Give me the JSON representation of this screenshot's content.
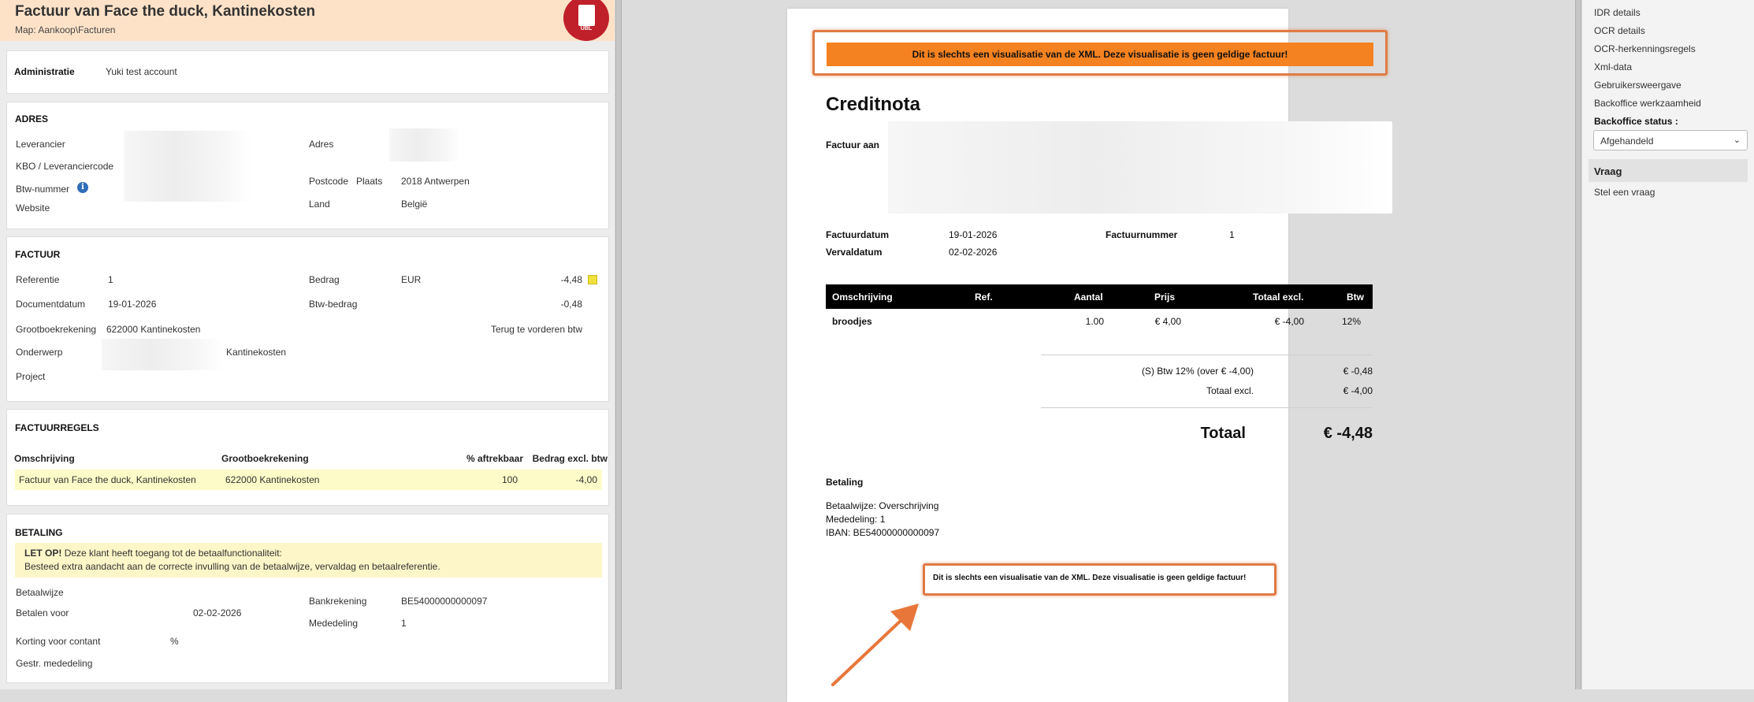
{
  "header": {
    "title": "Factuur van Face the duck, Kantinekosten",
    "folder": "Map: Aankoop\\Facturen",
    "ubl_label": "UBL"
  },
  "admin": {
    "label": "Administratie",
    "value": "Yuki test account"
  },
  "adres": {
    "title": "ADRES",
    "leverancier": "Leverancier",
    "kbo": "KBO / Leveranciercode",
    "btw": "Btw-nummer",
    "website": "Website",
    "adres": "Adres",
    "postcode": "Postcode",
    "plaats": "Plaats",
    "plaats_value": "2018 Antwerpen",
    "land": "Land",
    "land_value": "België"
  },
  "factuur": {
    "title": "FACTUUR",
    "referentie": "Referentie",
    "referentie_value": "1",
    "documentdatum": "Documentdatum",
    "documentdatum_value": "19-01-2026",
    "grootboek": "Grootboekrekening",
    "grootboek_value": "622000 Kantinekosten",
    "onderwerp": "Onderwerp",
    "onderwerp_value": "Kantinekosten",
    "project": "Project",
    "bedrag": "Bedrag",
    "currency": "EUR",
    "bedrag_value": "-4,48",
    "btw_bedrag": "Btw-bedrag",
    "btw_bedrag_value": "-0,48",
    "terug": "Terug te vorderen btw"
  },
  "regels": {
    "title": "FACTUURREGELS",
    "headers": [
      "Omschrijving",
      "Grootboekrekening",
      "% aftrekbaar",
      "Bedrag excl. btw"
    ],
    "row": [
      "Factuur van Face the duck, Kantinekosten",
      "622000 Kantinekosten",
      "100",
      "-4,00"
    ]
  },
  "betaling": {
    "title": "BETALING",
    "warn_bold": "LET OP!",
    "warn_text": "Deze klant heeft toegang tot de betaalfunctionaliteit:",
    "warn_line2": "Besteed extra aandacht aan de correcte invulling van de betaalwijze, vervaldag en betaalreferentie.",
    "betaalwijze": "Betaalwijze",
    "betalen_voor": "Betalen voor",
    "betalen_voor_value": "02-02-2026",
    "korting": "Korting voor contant",
    "korting_unit": "%",
    "gestr": "Gestr. mededeling",
    "bankrekening": "Bankrekening",
    "bankrekening_value": "BE54000000000097",
    "mededeling": "Mededeling",
    "mededeling_value": "1"
  },
  "doc": {
    "banner": "Dit is slechts een visualisatie van de XML. Deze visualisatie is geen geldige factuur!",
    "title": "Creditnota",
    "factuur_aan": "Factuur aan",
    "factuurdatum": "Factuurdatum",
    "factuurdatum_value": "19-01-2026",
    "vervaldatum": "Vervaldatum",
    "vervaldatum_value": "02-02-2026",
    "factuurnummer": "Factuurnummer",
    "factuurnummer_value": "1",
    "table_headers": [
      "Omschrijving",
      "Ref.",
      "Aantal",
      "Prijs",
      "Totaal excl.",
      "Btw"
    ],
    "line": [
      "broodjes",
      "1.00",
      "€ 4,00",
      "€ -4,00",
      "12%"
    ],
    "btw_line": "(S) Btw 12% (over € -4,00)",
    "btw_line_value": "€ -0,48",
    "totaal_excl": "Totaal excl.",
    "totaal_excl_value": "€ -4,00",
    "totaal": "Totaal",
    "totaal_value": "€ -4,48",
    "betaling_title": "Betaling",
    "betaalwijze": "Betaalwijze: Overschrijving",
    "mededeling": "Mededeling: 1",
    "iban": "IBAN: BE54000000000097"
  },
  "right": {
    "links": [
      "IDR details",
      "OCR details",
      "OCR-herkenningsregels",
      "Xml-data",
      "Gebruikersweergave",
      "Backoffice werkzaamheid"
    ],
    "status_label": "Backoffice status :",
    "status_value": "Afgehandeld",
    "vraag_title": "Vraag",
    "vraag_link": "Stel een vraag"
  },
  "colors": {
    "accent_orange": "#f58220",
    "highlight_border": "#e07b45",
    "ubl_red": "#c0202a",
    "row_yellow": "#fdfbc7"
  }
}
